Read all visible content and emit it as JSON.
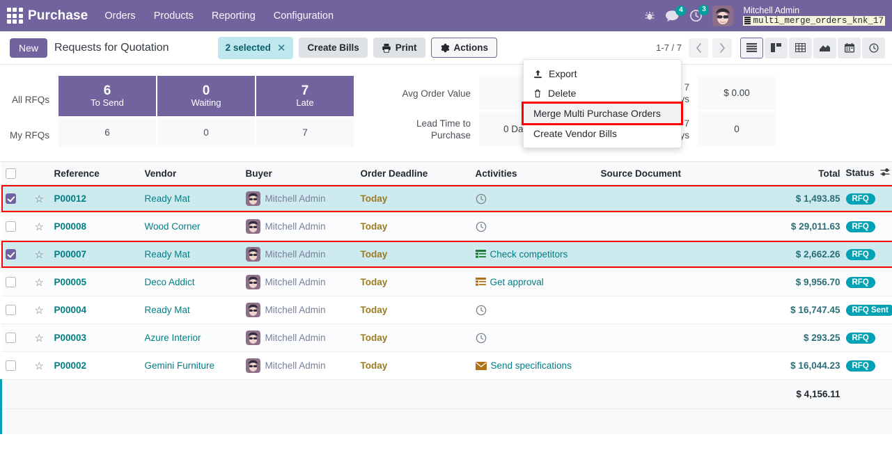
{
  "navbar": {
    "apps_icon": "apps-grid-icon",
    "brand": "Purchase",
    "menus": [
      {
        "label": "Orders"
      },
      {
        "label": "Products"
      },
      {
        "label": "Reporting"
      },
      {
        "label": "Configuration"
      }
    ],
    "bug_icon": "bug-icon",
    "messages_icon": "chat-bubble-icon",
    "messages_count": "4",
    "activities_icon": "clock-icon",
    "activities_count": "3",
    "avatar_icon": "user-avatar",
    "user_name": "Mitchell Admin",
    "db_icon": "database-icon",
    "db_name": "multi_merge_orders_knk_17"
  },
  "control_panel": {
    "new_label": "New",
    "title": "Requests for Quotation",
    "selection_label": "2 selected",
    "selection_clear_icon": "close-icon",
    "create_bills_label": "Create Bills",
    "print_icon": "printer-icon",
    "print_label": "Print",
    "actions_icon": "gear-icon",
    "actions_label": "Actions",
    "pager": "1-7 / 7",
    "prev_icon": "chevron-left-icon",
    "next_icon": "chevron-right-icon",
    "views": [
      {
        "name": "list-view-button",
        "icon": "list-icon",
        "active": true
      },
      {
        "name": "kanban-view-button",
        "icon": "kanban-icon",
        "active": false
      },
      {
        "name": "pivot-view-button",
        "icon": "pivot-table-icon",
        "active": false
      },
      {
        "name": "graph-view-button",
        "icon": "area-chart-icon",
        "active": false
      },
      {
        "name": "calendar-view-button",
        "icon": "calendar-icon",
        "active": false
      },
      {
        "name": "activity-view-button",
        "icon": "clock-icon",
        "active": false
      }
    ]
  },
  "actions_dropdown": {
    "items": [
      {
        "label": "Export",
        "icon": "upload-icon",
        "highlighted": false
      },
      {
        "label": "Delete",
        "icon": "trash-icon",
        "highlighted": false
      },
      {
        "label": "Merge Multi Purchase Orders",
        "icon": "",
        "highlighted": true
      },
      {
        "label": "Create Vendor Bills",
        "icon": "",
        "highlighted": false
      }
    ]
  },
  "dashboard": {
    "row_labels": [
      {
        "label": "All RFQs"
      },
      {
        "label": "My RFQs"
      }
    ],
    "columns": [
      {
        "number": "6",
        "caption": "To Send",
        "my_value": "6"
      },
      {
        "number": "0",
        "caption": "Waiting",
        "my_value": "0"
      },
      {
        "number": "7",
        "caption": "Late",
        "my_value": "7"
      }
    ],
    "middle": [
      {
        "label": "Avg Order Value",
        "value": ""
      },
      {
        "label": "Lead Time to Purchase",
        "value": "0 Days"
      }
    ],
    "right": [
      {
        "label": "Purchased Last 7 Days",
        "value": "$ 0.00"
      },
      {
        "label": "RFQs Sent Last 7 Days",
        "value": "0"
      }
    ]
  },
  "table": {
    "select_all_icon": "checkbox-icon",
    "columns": [
      {
        "label": "Reference"
      },
      {
        "label": "Vendor"
      },
      {
        "label": "Buyer"
      },
      {
        "label": "Order Deadline"
      },
      {
        "label": "Activities"
      },
      {
        "label": "Source Document"
      },
      {
        "label": "Total"
      },
      {
        "label": "Status"
      }
    ],
    "optional_columns_icon": "settings-sliders-icon",
    "rows": [
      {
        "selected": true,
        "highlighted": true,
        "reference": "P00012",
        "vendor": "Ready Mat",
        "buyer": "Mitchell Admin",
        "deadline": "Today",
        "activity_icon": "clock-icon",
        "activity": "",
        "source_document": "",
        "total": "$ 1,493.85",
        "status": "RFQ"
      },
      {
        "selected": false,
        "highlighted": false,
        "reference": "P00008",
        "vendor": "Wood Corner",
        "buyer": "Mitchell Admin",
        "deadline": "Today",
        "activity_icon": "clock-icon",
        "activity": "",
        "source_document": "",
        "total": "$ 29,011.63",
        "status": "RFQ"
      },
      {
        "selected": true,
        "highlighted": true,
        "reference": "P00007",
        "vendor": "Ready Mat",
        "buyer": "Mitchell Admin",
        "deadline": "Today",
        "activity_icon": "todo-list-green-icon",
        "activity": "Check competitors",
        "source_document": "",
        "total": "$ 2,662.26",
        "status": "RFQ"
      },
      {
        "selected": false,
        "highlighted": false,
        "reference": "P00005",
        "vendor": "Deco Addict",
        "buyer": "Mitchell Admin",
        "deadline": "Today",
        "activity_icon": "todo-list-orange-icon",
        "activity": "Get approval",
        "source_document": "",
        "total": "$ 9,956.70",
        "status": "RFQ"
      },
      {
        "selected": false,
        "highlighted": false,
        "reference": "P00004",
        "vendor": "Ready Mat",
        "buyer": "Mitchell Admin",
        "deadline": "Today",
        "activity_icon": "clock-icon",
        "activity": "",
        "source_document": "",
        "total": "$ 16,747.45",
        "status": "RFQ Sent"
      },
      {
        "selected": false,
        "highlighted": false,
        "reference": "P00003",
        "vendor": "Azure Interior",
        "buyer": "Mitchell Admin",
        "deadline": "Today",
        "activity_icon": "clock-icon",
        "activity": "",
        "source_document": "",
        "total": "$ 293.25",
        "status": "RFQ"
      },
      {
        "selected": false,
        "highlighted": false,
        "reference": "P00002",
        "vendor": "Gemini Furniture",
        "buyer": "Mitchell Admin",
        "deadline": "Today",
        "activity_icon": "envelope-orange-icon",
        "activity": "Send specifications",
        "source_document": "",
        "total": "$ 16,044.23",
        "status": "RFQ"
      }
    ],
    "footer_total": "$ 4,156.11"
  },
  "colors": {
    "brand_purple": "#71639e",
    "teal": "#00a2b3",
    "selected_row": "#cdeaee",
    "highlight_red": "#ff0000",
    "deadline_amber": "#9a7b1f"
  }
}
